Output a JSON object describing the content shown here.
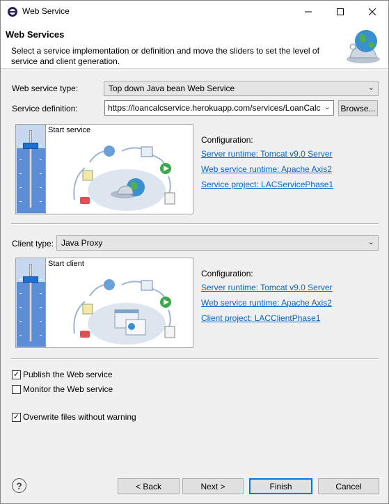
{
  "window": {
    "title": "Web Service"
  },
  "banner": {
    "title": "Web Services",
    "description": "Select a service implementation or definition and move the sliders to set the level of service and client generation."
  },
  "service": {
    "type_label": "Web service type:",
    "type_value": "Top down Java bean Web Service",
    "definition_label": "Service definition:",
    "definition_value": "https://loancalcservice.herokuapp.com/services/LoanCalc",
    "browse_label": "Browse...",
    "slider_caption": "Start service",
    "slider_level": 0.82,
    "config_title": "Configuration:",
    "server_runtime": "Server runtime: Tomcat v9.0 Server",
    "ws_runtime": "Web service runtime: Apache Axis2",
    "project": "Service project: LACServicePhase1"
  },
  "client": {
    "type_label": "Client type:",
    "type_value": "Java Proxy",
    "slider_caption": "Start client",
    "slider_level": 0.82,
    "config_title": "Configuration:",
    "server_runtime": "Server runtime: Tomcat v9.0 Server",
    "ws_runtime": "Web service runtime: Apache Axis2",
    "project": "Client project: LACClientPhase1"
  },
  "options": {
    "publish": {
      "label": "Publish the Web service",
      "checked": true
    },
    "monitor": {
      "label": "Monitor the Web service",
      "checked": false
    },
    "overwrite": {
      "label": "Overwrite files without warning",
      "checked": true
    }
  },
  "footer": {
    "back": "< Back",
    "next": "Next >",
    "finish": "Finish",
    "cancel": "Cancel"
  },
  "colors": {
    "link": "#0066cc",
    "accent": "#0078d7",
    "slider_fill": "#5b8ed6"
  }
}
